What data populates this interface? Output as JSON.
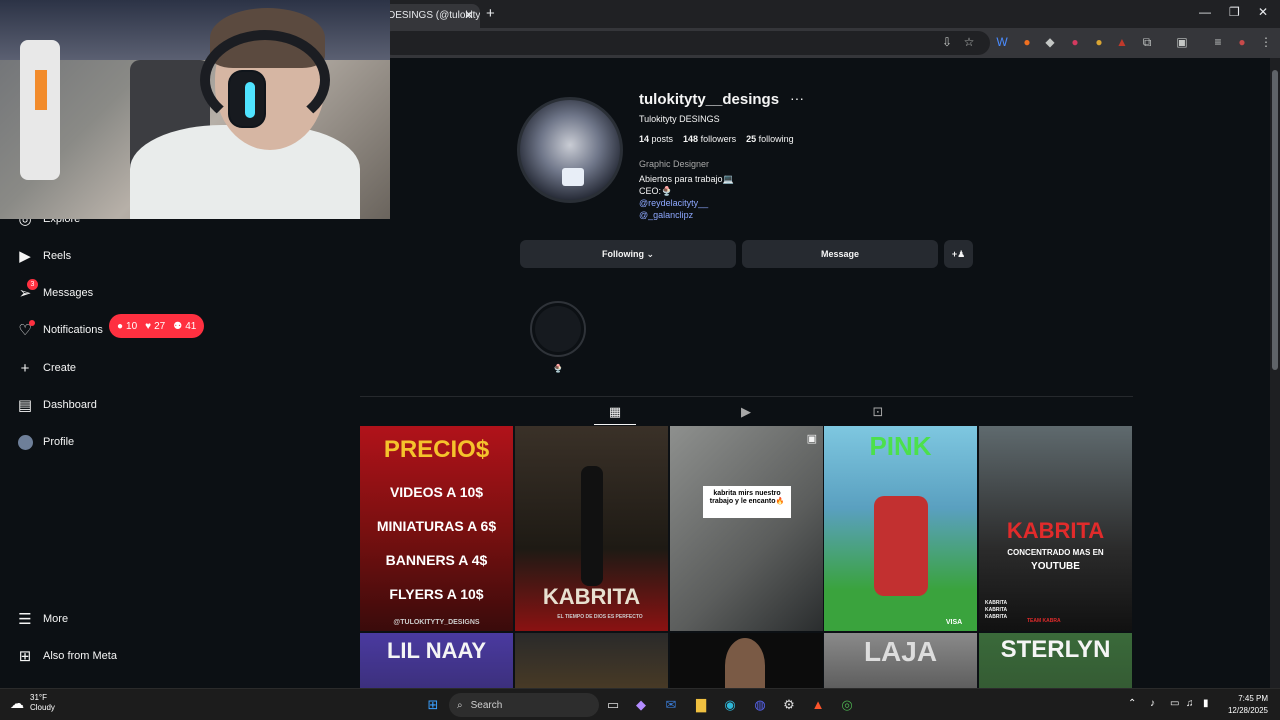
{
  "browser": {
    "tab_title": "DESINGS (@tulokity…",
    "tab_close": "✕",
    "new_tab": "+",
    "window_controls": [
      "—",
      "❐",
      "✕"
    ]
  },
  "sidebar": {
    "items": [
      {
        "label": "Explore",
        "icon": "compass-icon"
      },
      {
        "label": "Reels",
        "icon": "reels-icon"
      },
      {
        "label": "Messages",
        "icon": "messenger-icon",
        "badge": "3"
      },
      {
        "label": "Notifications",
        "icon": "heart-icon"
      },
      {
        "label": "Create",
        "icon": "plus-icon"
      },
      {
        "label": "Dashboard",
        "icon": "dashboard-icon"
      },
      {
        "label": "Profile",
        "icon": "avatar-icon"
      }
    ],
    "bottom": [
      {
        "label": "More",
        "icon": "menu-icon"
      },
      {
        "label": "Also from Meta",
        "icon": "meta-apps-icon"
      }
    ],
    "notification_pill": {
      "comments": "10",
      "likes": "27",
      "follows": "41"
    }
  },
  "profile": {
    "username": "tulokityty__desings",
    "more": "···",
    "full_name": "Tulokityty DESINGS",
    "stats": {
      "posts": "14",
      "posts_label": "posts",
      "followers": "148",
      "followers_label": "followers",
      "following": "25",
      "following_label": "following"
    },
    "category": "Graphic Designer",
    "bio_lines": [
      "Abiertos para trabajo💻",
      "CEO:🍨"
    ],
    "links": [
      "@reydelacityty__",
      "@_galanclipz"
    ],
    "buttons": {
      "following": "Following ⌄",
      "message": "Message",
      "add_user": "+♟"
    },
    "highlight_label": "🍨"
  },
  "grid_tabs": [
    "posts-grid-icon",
    "reels-icon",
    "tagged-icon"
  ],
  "posts": [
    {
      "lines": [
        "PRECIO$",
        "VIDEOS A 10$",
        "MINIATURAS A 6$",
        "BANNERS A 4$",
        "FLYERS A 10$",
        "@TULOKITYTY_DESIGNS"
      ],
      "bg": "#b1121a"
    },
    {
      "lines": [
        "KABRITA",
        "EL TIEMPO DE DIOS ES PERFECTO"
      ],
      "bg": "#1e1a14"
    },
    {
      "lines": [
        "kabrita mirs nuestro trabajo y le encanto🔥"
      ],
      "bg": "#6d6d6a"
    },
    {
      "lines": [
        "PINK",
        "VISA"
      ],
      "bg": "#3aa33d"
    },
    {
      "lines": [
        "KABRITA",
        "CONCENTRADO MAS EN",
        "YOUTUBE",
        "KABRITA",
        "KABRITA",
        "KABRITA",
        "TEAM KABRA"
      ],
      "bg": "#2b2b2b"
    },
    {
      "lines": [
        "LIL NAAY"
      ],
      "bg": "#3b2f7a"
    },
    {
      "lines": [
        ""
      ],
      "bg": "#2f2b20"
    },
    {
      "lines": [
        ""
      ],
      "bg": "#0c0c0c"
    },
    {
      "lines": [
        "LAJA"
      ],
      "bg": "#6a6a6a"
    },
    {
      "lines": [
        "STERLYN"
      ],
      "bg": "#345a33"
    }
  ],
  "taskbar": {
    "weather_temp": "31°F",
    "weather_desc": "Cloudy",
    "search_label": "Search",
    "time": "7:45 PM",
    "date": "12/28/2025"
  }
}
